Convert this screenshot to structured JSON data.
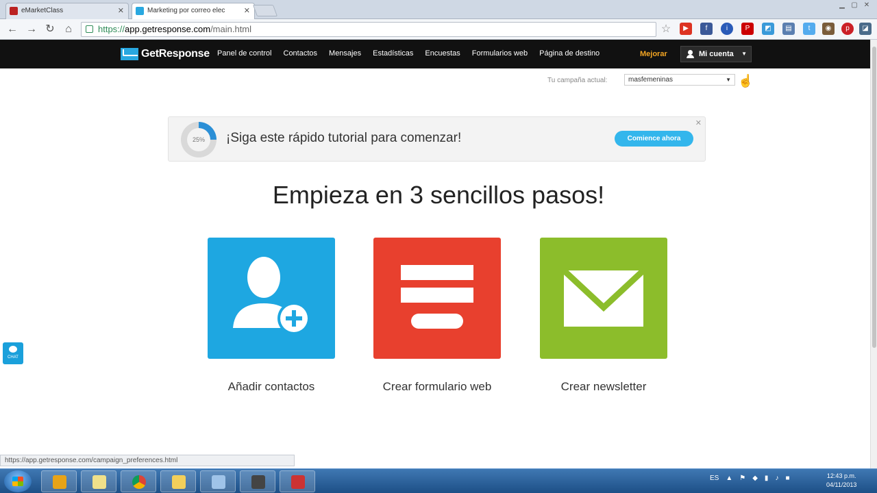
{
  "browser": {
    "tabs": [
      {
        "title": "eMarketClass",
        "active": false
      },
      {
        "title": "Marketing por correo elec",
        "active": true
      }
    ],
    "url": {
      "scheme": "https://",
      "host": "app.getresponse.com",
      "path": "/main.html"
    }
  },
  "app": {
    "brand": "GetResponse",
    "nav": [
      "Panel de control",
      "Contactos",
      "Mensajes",
      "Estadísticas",
      "Encuestas",
      "Formularios web",
      "Página de destino"
    ],
    "upgrade": "Mejorar",
    "account": "Mi cuenta"
  },
  "campaign": {
    "label": "Tu campaña actual:",
    "value": "masfemeninas"
  },
  "tutorial": {
    "progress": "25%",
    "text": "¡Siga este rápido tutorial para comenzar!",
    "button": "Comience ahora"
  },
  "headline": "Empieza en 3 sencillos pasos!",
  "steps": [
    {
      "label": "Añadir contactos",
      "color": "#1ea7e1"
    },
    {
      "label": "Crear formulario web",
      "color": "#e8402e"
    },
    {
      "label": "Crear newsletter",
      "color": "#8cbd2b"
    }
  ],
  "chat": {
    "label": "CHAT"
  },
  "status_url": "https://app.getresponse.com/campaign_preferences.html",
  "taskbar": {
    "lang": "ES",
    "time": "12:43 p.m.",
    "date": "04/11/2013"
  }
}
